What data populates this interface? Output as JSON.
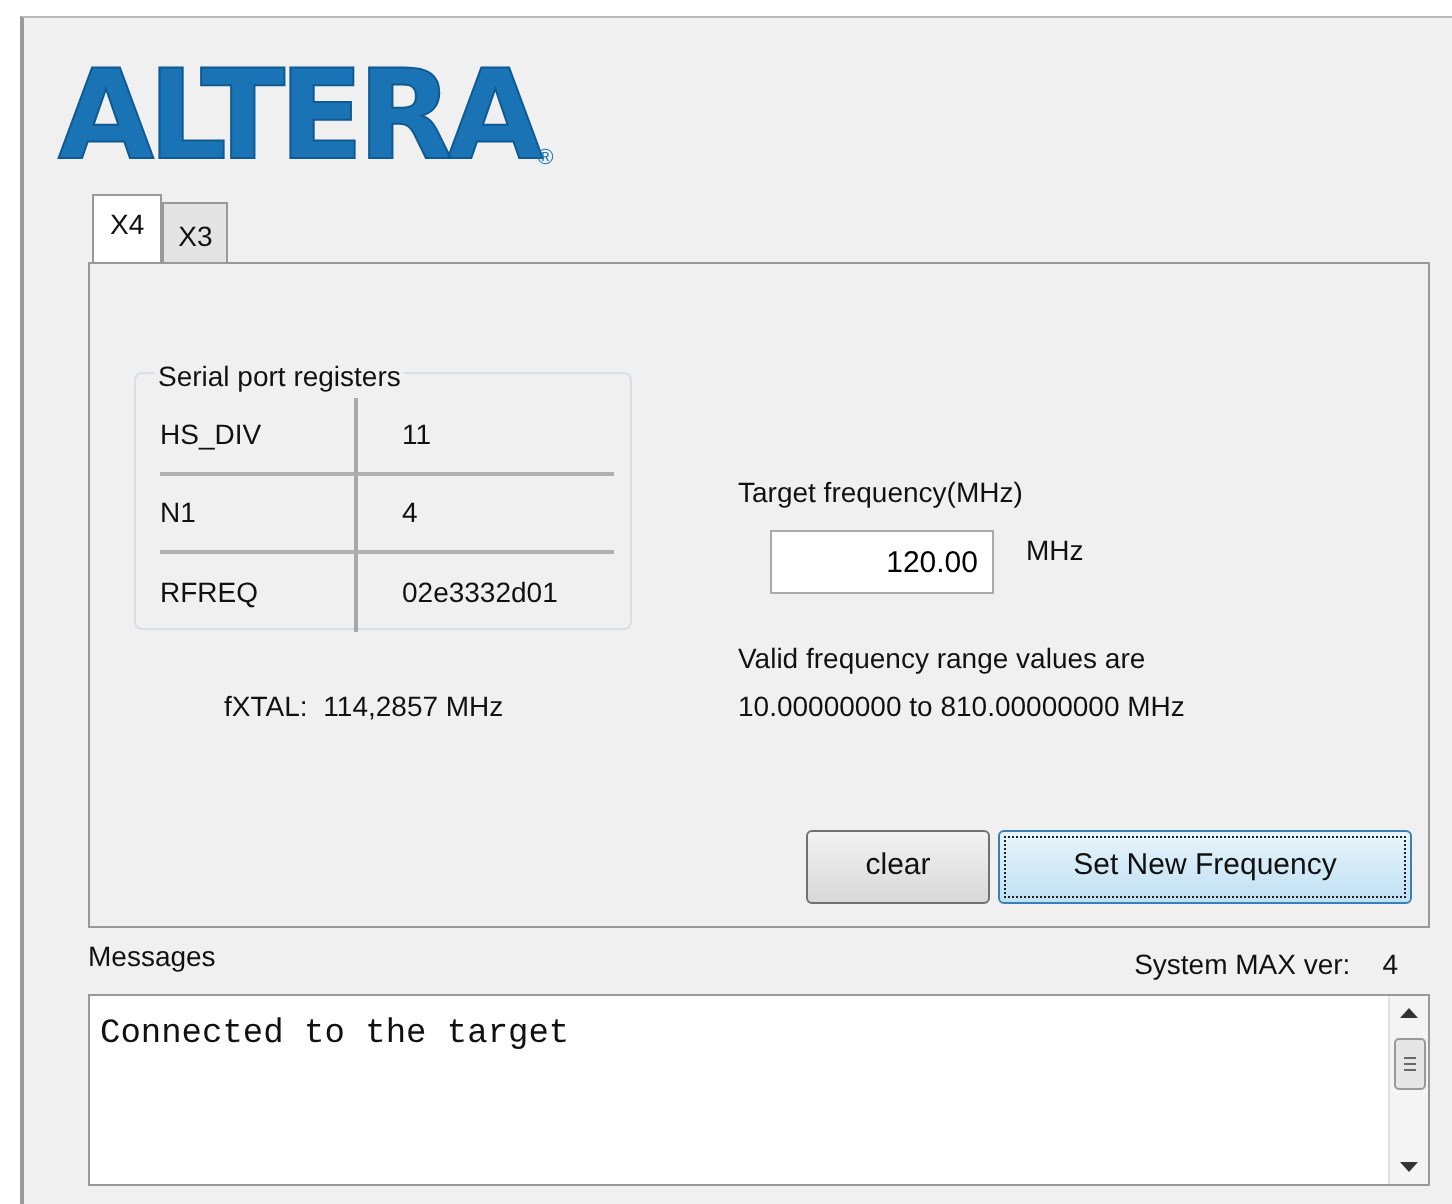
{
  "logo": {
    "text": "ALTERA",
    "mark": "®"
  },
  "tabs": [
    {
      "label": "X4",
      "selected": true
    },
    {
      "label": "X3",
      "selected": false
    }
  ],
  "registers": {
    "title": "Serial port registers",
    "rows": [
      {
        "name": "HS_DIV",
        "value": "11"
      },
      {
        "name": "N1",
        "value": "4"
      },
      {
        "name": "RFREQ",
        "value": "02e3332d01"
      }
    ]
  },
  "fxtal": {
    "label": "fXTAL:",
    "value": "114,2857 MHz"
  },
  "target": {
    "label": "Target frequency(MHz)",
    "value": "120.00",
    "unit": "MHz",
    "range_lines": [
      "Valid frequency range values are",
      "10.00000000 to 810.00000000 MHz"
    ]
  },
  "buttons": [
    {
      "label": "clear",
      "focused": false
    },
    {
      "label": "Set New Frequency",
      "focused": true
    }
  ],
  "messages": {
    "label": "Messages",
    "version_label": "System MAX ver:",
    "version": "4",
    "text": "Connected to the target"
  }
}
